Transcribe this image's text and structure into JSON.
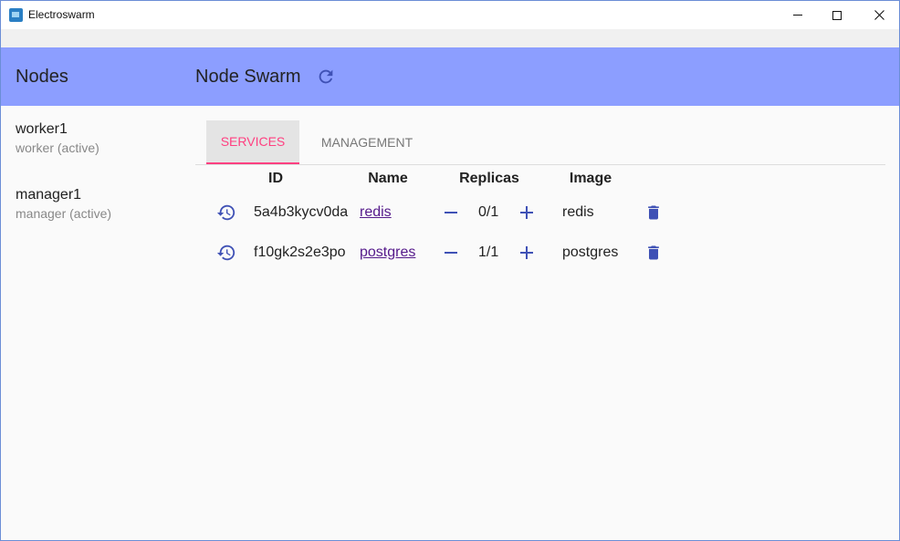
{
  "window": {
    "title": "Electroswarm",
    "accent_color": "#8c9eff",
    "icons": {
      "app": "electroswarm-app-icon",
      "minimize": "minimize-icon",
      "maximize": "maximize-icon",
      "close": "close-icon"
    }
  },
  "sidebar": {
    "title": "Nodes",
    "nodes": [
      {
        "name": "worker1",
        "role": "worker (active)"
      },
      {
        "name": "manager1",
        "role": "manager (active)"
      }
    ]
  },
  "main": {
    "title": "Node Swarm",
    "refresh_icon": "refresh-icon",
    "tabs": [
      {
        "label": "SERVICES",
        "active": true,
        "color": "#ff4081"
      },
      {
        "label": "MANAGEMENT",
        "active": false
      }
    ],
    "table": {
      "headers": {
        "id": "ID",
        "name": "Name",
        "replicas": "Replicas",
        "image": "Image"
      },
      "rows": [
        {
          "id": "5a4b3kycv0da",
          "name": "redis",
          "replicas": "0/1",
          "image": "redis"
        },
        {
          "id": "f10gk2s2e3po",
          "name": "postgres",
          "replicas": "1/1",
          "image": "postgres"
        }
      ],
      "row_icons": {
        "restart": "restart-icon",
        "decrease": "minus-icon",
        "increase": "plus-icon",
        "delete": "trash-icon"
      },
      "icon_color": "#3f51b5"
    }
  }
}
